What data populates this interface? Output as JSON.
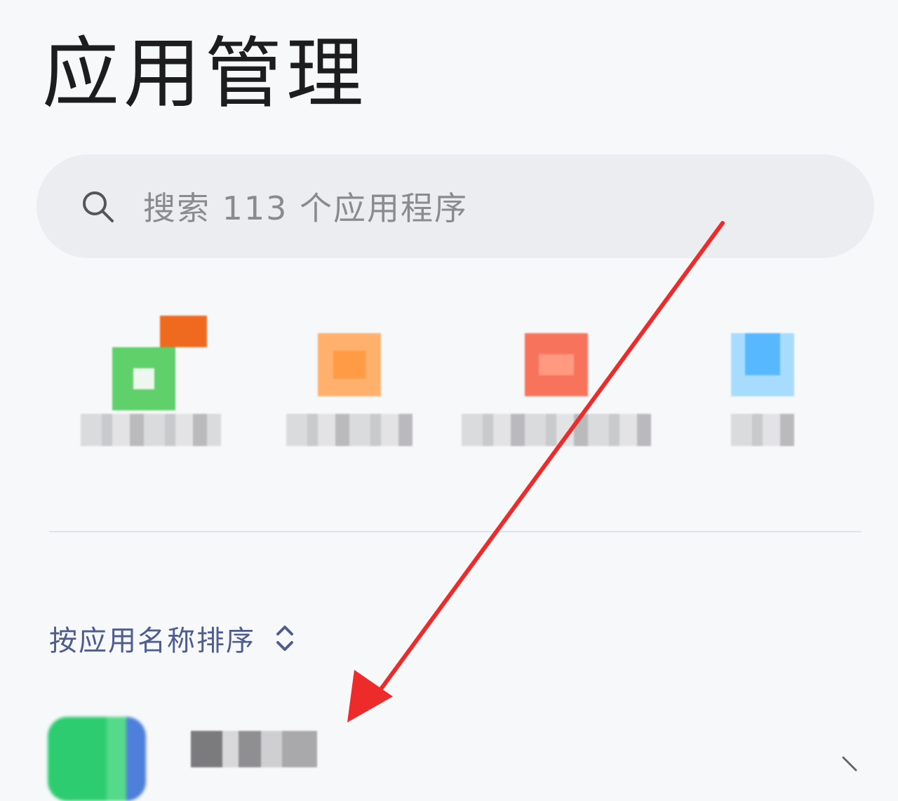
{
  "header": {
    "title": "应用管理"
  },
  "search": {
    "placeholder": "搜索 113 个应用程序",
    "icon": "search-icon"
  },
  "recent_apps": [
    {
      "label": "",
      "icon": "app-icon",
      "colors": [
        "#5fd06a",
        "#ef6a1f"
      ]
    },
    {
      "label": "",
      "icon": "app-icon",
      "colors": [
        "#ffa65a",
        "#ffc27e"
      ]
    },
    {
      "label": "",
      "icon": "app-icon",
      "colors": [
        "#f8735b",
        "#ffb19a"
      ]
    },
    {
      "label": "",
      "icon": "app-icon",
      "colors": [
        "#58b8ff",
        "#a8dcff"
      ]
    }
  ],
  "sort": {
    "label": "按应用名称排序",
    "icon": "sort-icon"
  },
  "app_list": {
    "items": [
      {
        "label": "",
        "icon": "app-icon"
      }
    ]
  },
  "colors": {
    "background": "#f7f8fa",
    "search_bg": "#ecedf0",
    "sort_text": "#4f5c8e",
    "annotation_arrow": "#ee2b2b"
  }
}
